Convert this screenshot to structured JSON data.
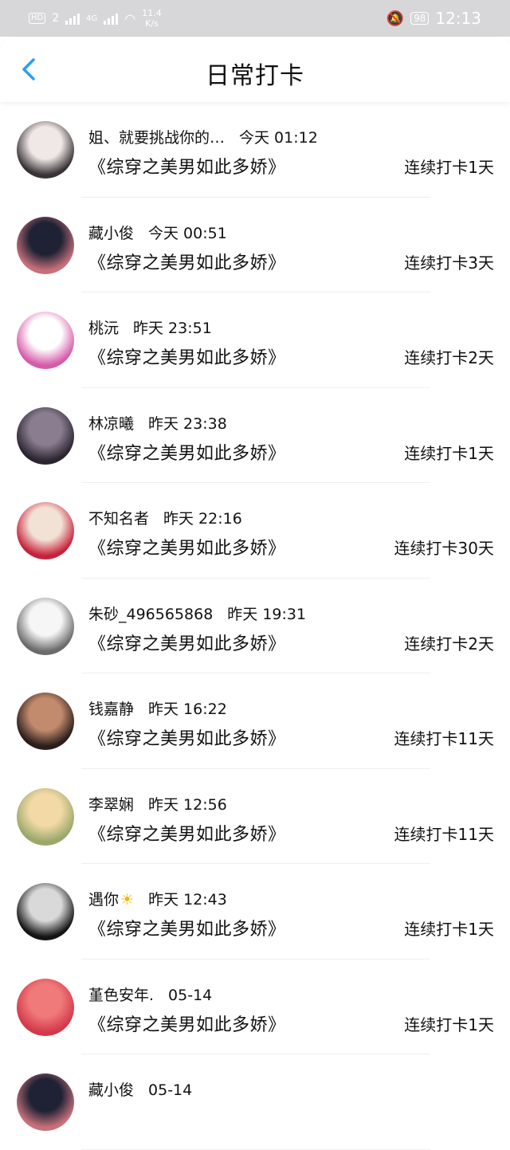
{
  "status_bar": {
    "hd_label": "HD",
    "sim": "2",
    "net": "4G",
    "speed_value": "11.4",
    "speed_unit": "K/s",
    "battery": "98",
    "time": "12:13"
  },
  "header": {
    "title": "日常打卡"
  },
  "entries": [
    {
      "name": "姐、就要挑战你的…",
      "time": "今天 01:12",
      "book": "《综穿之美男如此多娇》",
      "streak": "连续打卡1天",
      "avatar_colors": [
        "#efe8e6",
        "#3a3336"
      ]
    },
    {
      "name": "藏小俊",
      "time": "今天 00:51",
      "book": "《综穿之美男如此多娇》",
      "streak": "连续打卡3天",
      "avatar_colors": [
        "#1e2234",
        "#c7707a"
      ]
    },
    {
      "name": "桃沅",
      "time": "昨天 23:51",
      "book": "《综穿之美男如此多娇》",
      "streak": "连续打卡2天",
      "avatar_colors": [
        "#ffffff",
        "#d75aa8"
      ]
    },
    {
      "name": "林凉曦",
      "time": "昨天 23:38",
      "book": "《综穿之美男如此多娇》",
      "streak": "连续打卡1天",
      "avatar_colors": [
        "#8a7d90",
        "#2b2530"
      ]
    },
    {
      "name": "不知名者",
      "time": "昨天 22:16",
      "book": "《综穿之美男如此多娇》",
      "streak": "连续打卡30天",
      "avatar_colors": [
        "#f2e2d6",
        "#c8213a"
      ]
    },
    {
      "name": "朱砂_496565868",
      "time": "昨天 19:31",
      "book": "《综穿之美男如此多娇》",
      "streak": "连续打卡2天",
      "avatar_colors": [
        "#f6f6f6",
        "#6b6b6b"
      ]
    },
    {
      "name": "钱嘉静",
      "time": "昨天 16:22",
      "book": "《综穿之美男如此多娇》",
      "streak": "连续打卡11天",
      "avatar_colors": [
        "#c28b6e",
        "#2a1d1a"
      ]
    },
    {
      "name": "李翠娴",
      "time": "昨天 12:56",
      "book": "《综穿之美男如此多娇》",
      "streak": "连续打卡11天",
      "avatar_colors": [
        "#f2d9a6",
        "#9aa86a"
      ]
    },
    {
      "name": "遇你",
      "time": "昨天 12:43",
      "book": "《综穿之美男如此多娇》",
      "streak": "连续打卡1天",
      "avatar_colors": [
        "#d9d9d9",
        "#141414"
      ],
      "emoji": "☀"
    },
    {
      "name": "堇色安年.",
      "time": "05-14",
      "book": "《综穿之美男如此多娇》",
      "streak": "连续打卡1天",
      "avatar_colors": [
        "#f07a7a",
        "#d2394a"
      ]
    },
    {
      "name": "藏小俊",
      "time": "05-14",
      "book": "",
      "streak": "",
      "avatar_colors": [
        "#1e2234",
        "#c7707a"
      ]
    }
  ]
}
